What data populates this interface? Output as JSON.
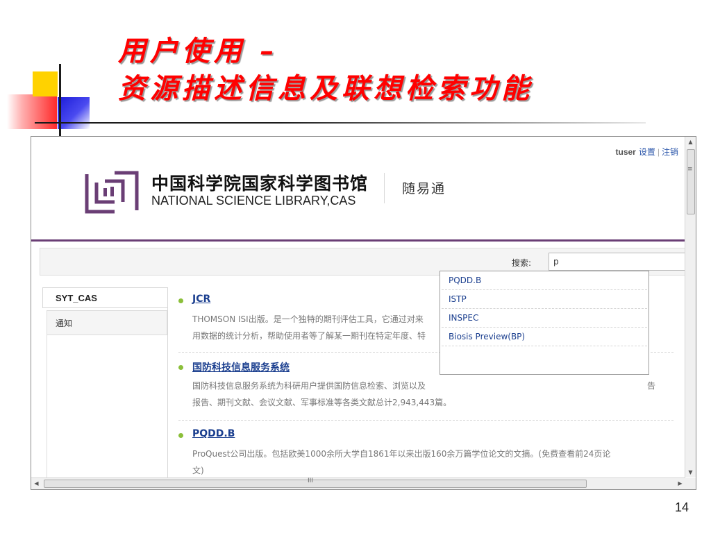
{
  "slide": {
    "title_line1": "用户使用 –",
    "title_line2": "资源描述信息及联想检索功能",
    "page_number": "14"
  },
  "header": {
    "username": "tuser",
    "settings_link": "设置",
    "logout_link": "注销",
    "logo_cn": "中国科学院国家科学图书馆",
    "logo_en": "NATIONAL SCIENCE LIBRARY,CAS",
    "brand": "随易通",
    "accent_color": "#6a3e75"
  },
  "search": {
    "label": "搜索:",
    "value": "p",
    "suggestions": [
      "PQDD.B",
      "ISTP",
      "INSPEC",
      "Biosis Preview(BP)"
    ]
  },
  "sidebar": {
    "tab": "SYT_CAS",
    "item": "通知"
  },
  "results": [
    {
      "title": "JCR",
      "desc_line1": "THOMSON ISI出版。是一个独特的期刊评估工具，它通过对来",
      "desc_line2": "用数据的统计分析，帮助使用者等了解某一期刊在特定年度、特"
    },
    {
      "title": "国防科技信息服务系统",
      "desc_line1": "国防科技信息服务系统为科研用户提供国防信息检索、浏览以及",
      "desc_line1_tail": "告",
      "desc_line2": "报告、期刊文献、会议文献、军事标准等各类文献总计2,943,443篇。"
    },
    {
      "title": "PQDD.B",
      "desc_line1": "ProQuest公司出版。包括欧美1000余所大学自1861年以来出版160余万篇学位论文的文摘。(免费查看前24页论",
      "desc_line2": "文)"
    }
  ],
  "scrollbar": {
    "grip_v": "≡",
    "grip_h": "III",
    "arrow_up": "▲",
    "arrow_down": "▼",
    "arrow_left": "◀",
    "arrow_right": "▶"
  }
}
